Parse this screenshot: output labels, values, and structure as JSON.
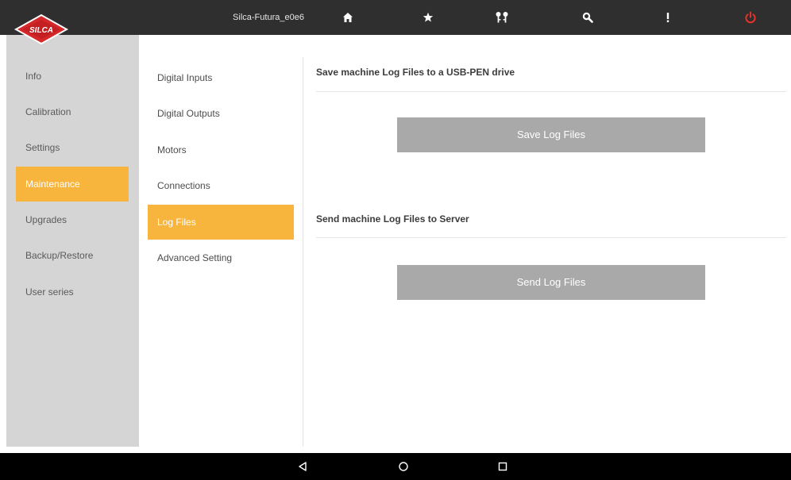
{
  "header": {
    "logo_text": "SILCA",
    "device_name": "Silca-Futura_e0e6",
    "icons": [
      "home-icon",
      "star-icon",
      "keys-icon",
      "search-icon",
      "more-vertical-icon",
      "power-icon"
    ],
    "power_color": "#e8332a"
  },
  "main_menu": {
    "items": [
      {
        "label": "Info"
      },
      {
        "label": "Calibration"
      },
      {
        "label": "Settings"
      },
      {
        "label": "Maintenance"
      },
      {
        "label": "Upgrades"
      },
      {
        "label": "Backup/Restore"
      },
      {
        "label": "User series"
      }
    ],
    "active": "Maintenance"
  },
  "sub_menu": {
    "items": [
      {
        "label": "Digital Inputs"
      },
      {
        "label": "Digital Outputs"
      },
      {
        "label": "Motors"
      },
      {
        "label": "Connections"
      },
      {
        "label": "Log Files"
      },
      {
        "label": "Advanced Setting"
      }
    ],
    "active": "Log Files"
  },
  "content": {
    "usb_section": {
      "title": "Save machine Log Files to a USB-PEN drive",
      "button_label": "Save Log Files"
    },
    "server_section": {
      "title": "Send machine Log Files to Server",
      "button_label": "Send Log Files"
    }
  },
  "colors": {
    "accent": "#f8b53e",
    "topbar": "#2f2f2f",
    "sidebar": "#d5d5d5",
    "button": "#a9a9a9"
  },
  "navbar": {
    "icons": [
      "back-icon",
      "home-circle-icon",
      "recents-icon"
    ]
  }
}
